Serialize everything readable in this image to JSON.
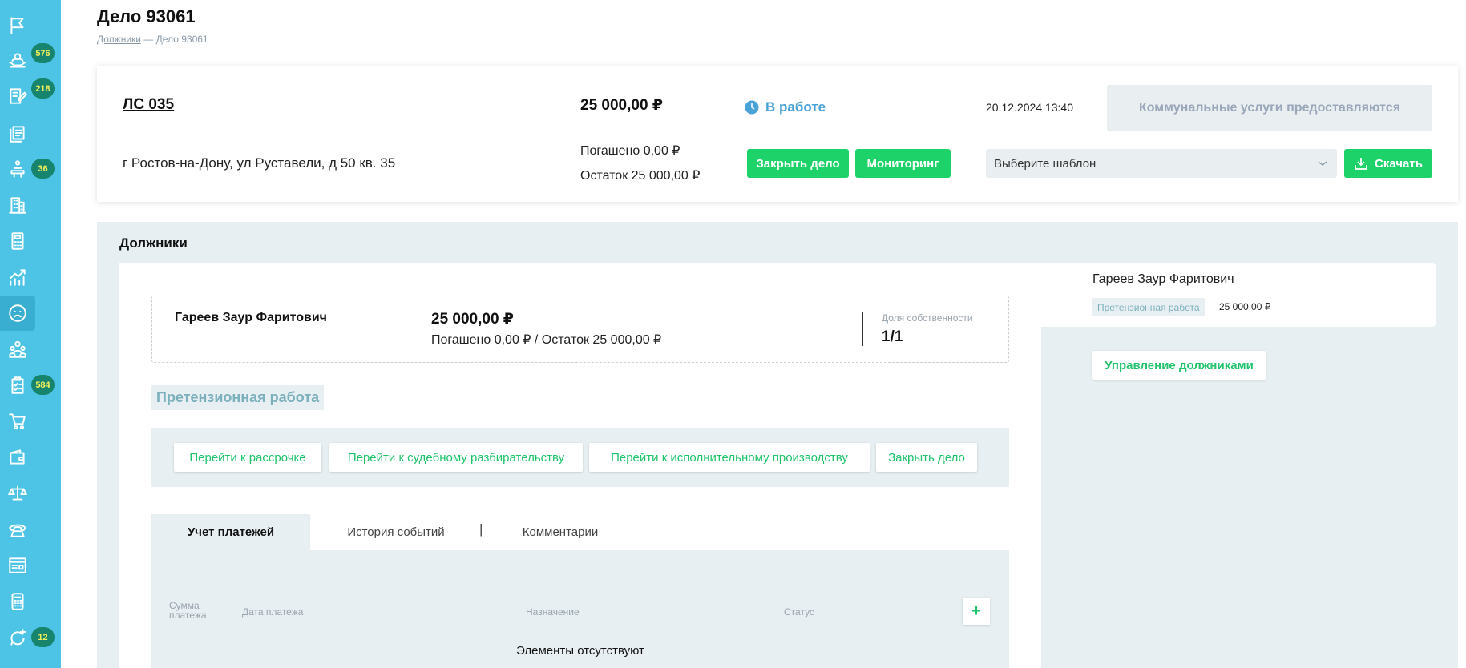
{
  "sidebar": {
    "badges": {
      "clients": "576",
      "edits": "218",
      "meters": "36",
      "tasks": "584",
      "chats": "12"
    }
  },
  "page": {
    "title": "Дело 93061",
    "breadcrumb": {
      "link": "Должники",
      "separator": "—",
      "current": "Дело 93061"
    }
  },
  "case": {
    "account": "ЛС 035",
    "address": "г Ростов-на-Дону, ул Руставели, д 50 кв. 35",
    "amount": "25 000,00 ₽",
    "paid": "Погашено 0,00 ₽",
    "remaining": "Остаток 25 000,00 ₽",
    "status": "В работе",
    "datetime": "20.12.2024 13:40",
    "utility_notice": "Коммунальные услуги предоставляются",
    "close_button": "Закрыть дело",
    "monitor_button": "Мониторинг",
    "template_placeholder": "Выберите шаблон",
    "download_button": "Скачать"
  },
  "debtors": {
    "section_title": "Должники",
    "card": {
      "name": "Гареев Заур Фаритович",
      "amount": "25 000,00 ₽",
      "paid_remaining": "Погашено 0,00 ₽ / Остаток 25 000,00 ₽",
      "share_label": "Доля собственности",
      "share_value": "1/1"
    },
    "stage_label": "Претензионная работа",
    "actions": [
      "Перейти к рассрочке",
      "Перейти к судебному разбирательству",
      "Перейти к исполнительному производству",
      "Закрыть дело"
    ],
    "tabs": [
      "Учет платежей",
      "История событий",
      "Комментарии"
    ],
    "tab_separator": "|",
    "table": {
      "headers": [
        "Сумма платежа",
        "Дата платежа",
        "Назначение",
        "Статус"
      ],
      "add_button": "+",
      "empty": "Элементы отсутствуют"
    },
    "side": {
      "name": "Гареев Заур Фаритович",
      "stage": "Претензионная работа",
      "amount": "25 000,00 ₽",
      "manage_button": "Управление должниками"
    }
  },
  "colors": {
    "sidebar": "#4dc4e6",
    "green": "#1ed26a",
    "section_bg": "#e7eff2",
    "badge": "#17856e"
  }
}
